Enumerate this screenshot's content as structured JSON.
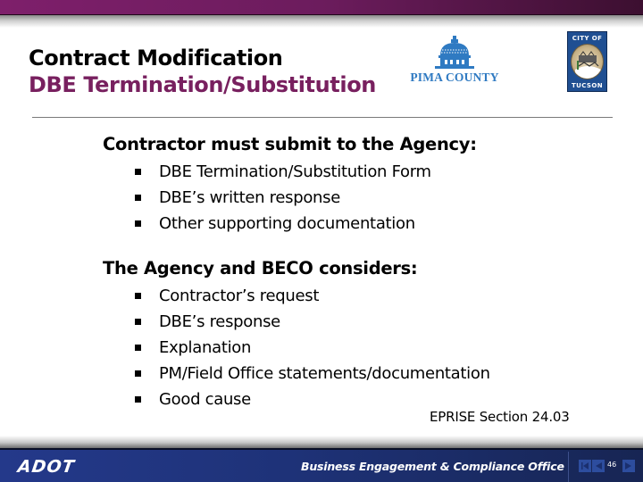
{
  "header": {
    "title_line1": "Contract Modification",
    "title_line2": "DBE Termination/Substitution",
    "accent_color": "#78205f",
    "bar_color": "#7e1f6b"
  },
  "logos": {
    "pima": {
      "text": "PIMA COUNTY",
      "color": "#2f7ac2"
    },
    "tucson": {
      "top_text": "CITY OF",
      "bottom_text": "TUCSON",
      "color": "#1f4f92"
    }
  },
  "sections": [
    {
      "heading": "Contractor must submit to the Agency:",
      "bullets": [
        "DBE Termination/Substitution Form",
        "DBE’s written response",
        "Other supporting documentation"
      ]
    },
    {
      "heading": "The Agency and BECO considers:",
      "bullets": [
        "Contractor’s request",
        "DBE’s response",
        "Explanation",
        "PM/Field Office statements/documentation",
        "Good cause"
      ]
    }
  ],
  "citation": "EPRISE Section 24.03",
  "footer": {
    "logo_text": "ADOT",
    "office": "Business Engagement & Compliance Office",
    "page_number": "46",
    "nav": {
      "first_icon": "skip-to-first-icon",
      "prev_icon": "previous-icon",
      "next_icon": "next-icon"
    },
    "background_color": "#1e3278"
  }
}
